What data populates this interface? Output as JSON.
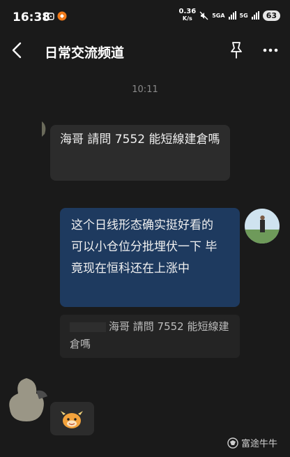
{
  "status_bar": {
    "time": "16:38",
    "net_speed": "0.36",
    "net_unit": "K/s",
    "sim1": "5GA",
    "sim2": "5G",
    "battery": "63"
  },
  "header": {
    "title": "日常交流频道"
  },
  "chat": {
    "timestamp": "10:11",
    "messages": [
      {
        "side": "left",
        "text": "海哥 請問 7552 能短線建倉嗎"
      },
      {
        "side": "right",
        "text": "这个日线形态确实挺好看的   可以小仓位分批埋伏一下   毕竟现在恒科还在上涨中"
      },
      {
        "quote": "海哥 請問 7552 能短線建倉嗎"
      }
    ]
  },
  "watermark": "富途牛牛",
  "colors": {
    "background": "#1a1a1a",
    "bubble_left": "#2c2c2c",
    "bubble_right": "#1e3a5f"
  }
}
